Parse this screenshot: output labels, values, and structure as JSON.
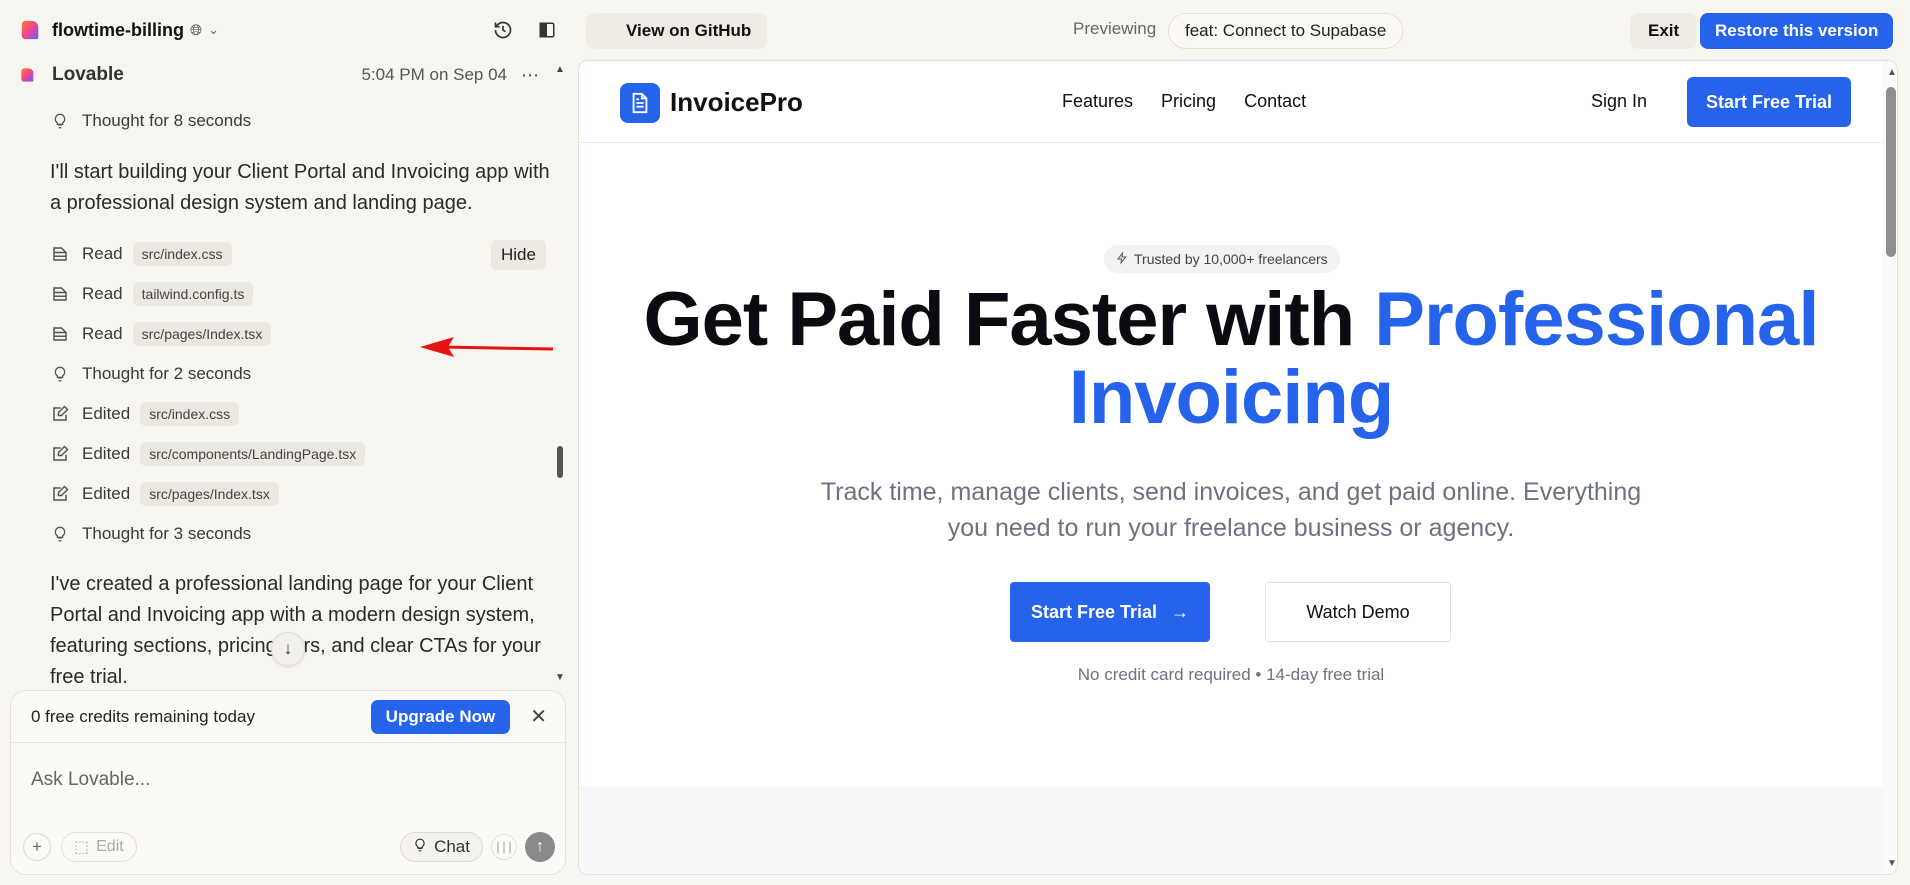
{
  "project": {
    "name": "flowtime-billing"
  },
  "chat": {
    "author": "Lovable",
    "timestamp": "5:04 PM on Sep 04",
    "hide_label": "Hide",
    "paragraph1": "I'll start building your Client Portal and Invoicing app with a professional design system and landing page.",
    "paragraph2": "I've created a professional landing page for your Client Portal and Invoicing app with a modern design system, featuring sections, pricing tiers, and clear CTAs for your free trial.",
    "steps": [
      {
        "icon": "lightbulb-icon",
        "verb": "Thought for 8 seconds",
        "file": ""
      },
      {
        "icon": "file-icon",
        "verb": "Read",
        "file": "src/index.css"
      },
      {
        "icon": "file-icon",
        "verb": "Read",
        "file": "tailwind.config.ts"
      },
      {
        "icon": "file-icon",
        "verb": "Read",
        "file": "src/pages/Index.tsx"
      },
      {
        "icon": "lightbulb-icon",
        "verb": "Thought for 2 seconds",
        "file": ""
      },
      {
        "icon": "edit-file-icon",
        "verb": "Edited",
        "file": "src/index.css"
      },
      {
        "icon": "edit-file-icon",
        "verb": "Edited",
        "file": "src/components/LandingPage.tsx"
      },
      {
        "icon": "edit-file-icon",
        "verb": "Edited",
        "file": "src/pages/Index.tsx"
      },
      {
        "icon": "lightbulb-icon",
        "verb": "Thought for 3 seconds",
        "file": ""
      }
    ]
  },
  "composer": {
    "credits_text": "0 free credits remaining today",
    "upgrade_label": "Upgrade Now",
    "placeholder": "Ask Lovable...",
    "edit_label": "Edit",
    "chat_label": "Chat"
  },
  "toolbar": {
    "github_label": "View on GitHub",
    "previewing_label": "Previewing",
    "version_label": "feat: Connect to Supabase",
    "exit_label": "Exit",
    "restore_label": "Restore this version"
  },
  "site": {
    "brand": "InvoicePro",
    "nav": [
      "Features",
      "Pricing",
      "Contact"
    ],
    "signin": "Sign In",
    "nav_cta": "Start Free Trial",
    "badge": "Trusted by 10,000+ freelancers",
    "title_main": "Get Paid Faster with ",
    "title_accent1": "Professional",
    "title_accent2": "Invoicing",
    "subtitle": "Track time, manage clients, send invoices, and get paid online. Everything you need to run your freelance business or agency.",
    "cta_primary": "Start Free Trial",
    "cta_secondary": "Watch Demo",
    "note": "No credit card required • 14-day free trial"
  },
  "colors": {
    "accent": "#2563eb",
    "annotation_arrow": "#e81313"
  }
}
